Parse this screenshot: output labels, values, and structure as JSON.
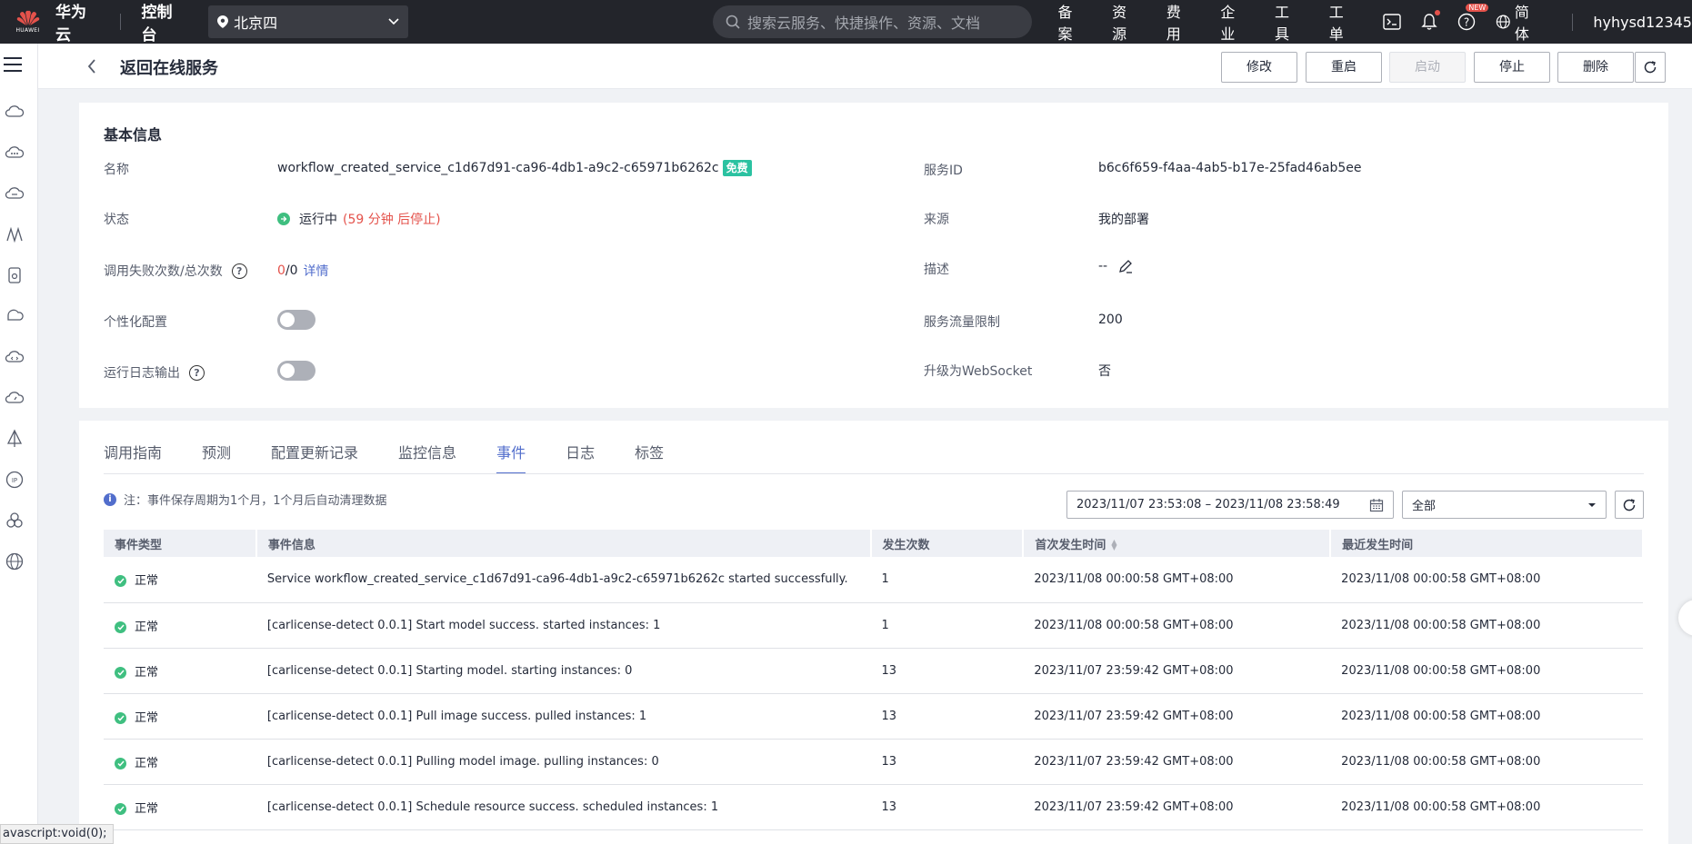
{
  "topbar": {
    "logo_small": "HUAWEI",
    "brand": "华为云",
    "console": "控制台",
    "region": "北京四",
    "search_placeholder": "搜索云服务、快捷操作、资源、文档",
    "nav": [
      "备案",
      "资源",
      "费用",
      "企业",
      "工具",
      "工单"
    ],
    "help_badge": "NEW",
    "lang": "简体",
    "user": "hyhysd12345"
  },
  "header": {
    "title": "返回在线服务",
    "buttons": {
      "modify": "修改",
      "restart": "重启",
      "start": "启动",
      "stop": "停止",
      "delete": "删除"
    }
  },
  "basic": {
    "title": "基本信息",
    "name_label": "名称",
    "name_value": "workflow_created_service_c1d67d91-ca96-4db1-a9c2-c65971b6262c",
    "free_badge": "免费",
    "status_label": "状态",
    "status_value": "运行中",
    "status_note": "(59 分钟 后停止)",
    "calls_label": "调用失败次数/总次数",
    "calls_failed": "0",
    "calls_total": "/0",
    "calls_link": "详情",
    "custom_label": "个性化配置",
    "log_label": "运行日志输出",
    "service_id_label": "服务ID",
    "service_id_value": "b6c6f659-f4aa-4ab5-b17e-25fad46ab5ee",
    "source_label": "来源",
    "source_value": "我的部署",
    "desc_label": "描述",
    "desc_value": "--",
    "limit_label": "服务流量限制",
    "limit_value": "200",
    "ws_label": "升级为WebSocket",
    "ws_value": "否"
  },
  "tabs": [
    "调用指南",
    "预测",
    "配置更新记录",
    "监控信息",
    "事件",
    "日志",
    "标签"
  ],
  "events": {
    "notice": "注：事件保存周期为1个月，1个月后自动清理数据",
    "date_range": "2023/11/07 23:53:08 – 2023/11/08 23:58:49",
    "filter": "全部",
    "columns": [
      "事件类型",
      "事件信息",
      "发生次数",
      "首次发生时间",
      "最近发生时间"
    ],
    "rows": [
      {
        "type": "正常",
        "info": "Service workflow_created_service_c1d67d91-ca96-4db1-a9c2-c65971b6262c started successfully.",
        "count": "1",
        "first": "2023/11/08 00:00:58 GMT+08:00",
        "last": "2023/11/08 00:00:58 GMT+08:00"
      },
      {
        "type": "正常",
        "info": "[carlicense-detect 0.0.1] Start model success. started instances: 1",
        "count": "1",
        "first": "2023/11/08 00:00:58 GMT+08:00",
        "last": "2023/11/08 00:00:58 GMT+08:00"
      },
      {
        "type": "正常",
        "info": "[carlicense-detect 0.0.1] Starting model. starting instances: 0",
        "count": "13",
        "first": "2023/11/07 23:59:42 GMT+08:00",
        "last": "2023/11/08 00:00:58 GMT+08:00"
      },
      {
        "type": "正常",
        "info": "[carlicense-detect 0.0.1] Pull image success. pulled instances: 1",
        "count": "13",
        "first": "2023/11/07 23:59:42 GMT+08:00",
        "last": "2023/11/08 00:00:58 GMT+08:00"
      },
      {
        "type": "正常",
        "info": "[carlicense-detect 0.0.1] Pulling model image. pulling instances: 0",
        "count": "13",
        "first": "2023/11/07 23:59:42 GMT+08:00",
        "last": "2023/11/08 00:00:58 GMT+08:00"
      },
      {
        "type": "正常",
        "info": "[carlicense-detect 0.0.1] Schedule resource success. scheduled instances: 1",
        "count": "13",
        "first": "2023/11/07 23:59:42 GMT+08:00",
        "last": "2023/11/08 00:00:58 GMT+08:00"
      }
    ]
  },
  "statusbar": "avascript:void(0);",
  "colors": {
    "topbar": "#23252b",
    "accent": "#526ecc",
    "success": "#3fbf80",
    "danger": "#e4524b",
    "free": "#2bc2a1"
  }
}
